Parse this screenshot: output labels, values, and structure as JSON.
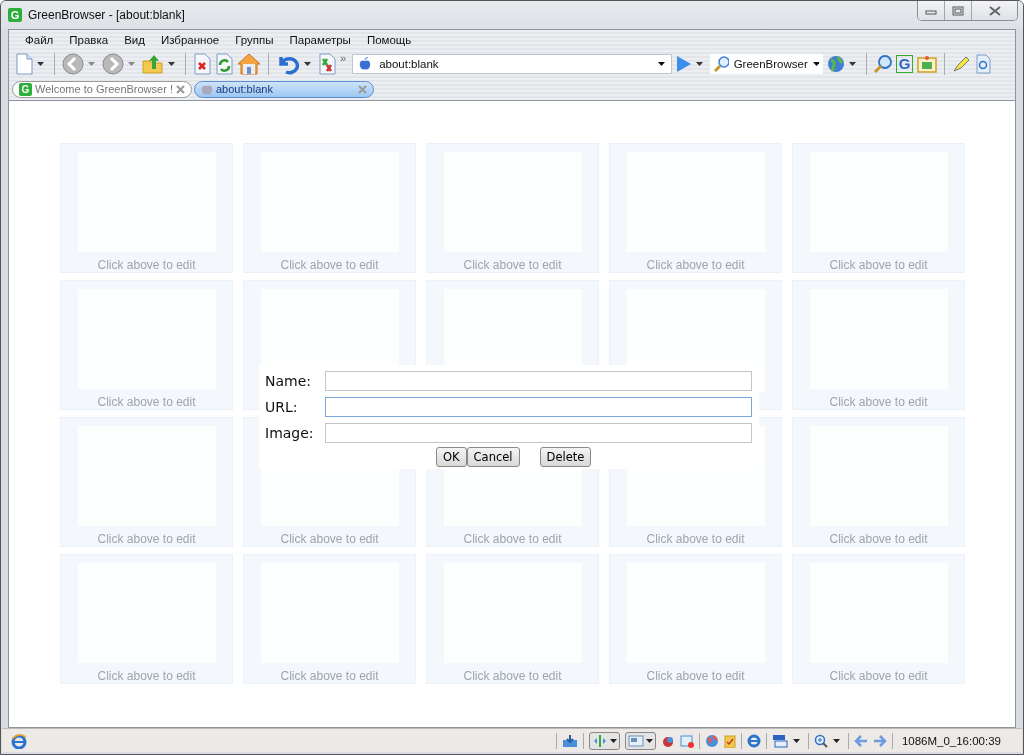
{
  "window": {
    "title": "GreenBrowser - [about:blank]",
    "icon_letter": "G"
  },
  "menu": [
    "Файл",
    "Правка",
    "Вид",
    "Избранное",
    "Группы",
    "Параметры",
    "Помощь"
  ],
  "toolbar": {
    "overflow": "»",
    "address": "about:blank",
    "search_engine": "GreenBrowser",
    "logo_letter": "G"
  },
  "tabs": [
    {
      "label": "Welcome to GreenBrowser !",
      "icon_letter": "G",
      "selected": false
    },
    {
      "label": "about:blank",
      "selected": true
    }
  ],
  "tiles": [
    {
      "caption": "Click above to edit"
    },
    {
      "caption": "Click above to edit"
    },
    {
      "caption": "Click above to edit"
    },
    {
      "caption": "Click above to edit"
    },
    {
      "caption": "Click above to edit"
    },
    {
      "caption": "Click above to edit"
    },
    {
      "kind": "covered"
    },
    {
      "kind": "covered"
    },
    {
      "kind": "covered"
    },
    {
      "caption": "Click above to edit"
    },
    {
      "caption": "Click above to edit"
    },
    {
      "caption": "Click above to edit"
    },
    {
      "caption": "Click above to edit"
    },
    {
      "caption": "Click above to edit"
    },
    {
      "caption": "Click above to edit"
    },
    {
      "caption": "Click above to edit"
    },
    {
      "caption": "Click above to edit"
    },
    {
      "caption": "Click above to edit"
    },
    {
      "caption": "Click above to edit"
    },
    {
      "caption": "Click above to edit"
    }
  ],
  "editor": {
    "fields": [
      {
        "label": "Name:",
        "focused": false
      },
      {
        "label": "URL:",
        "focused": true
      },
      {
        "label": "Image:",
        "focused": false
      }
    ],
    "buttons": [
      "OK",
      "Cancel",
      "Delete"
    ]
  },
  "status_bar": {
    "info": "1086M_0_16:00:39"
  }
}
